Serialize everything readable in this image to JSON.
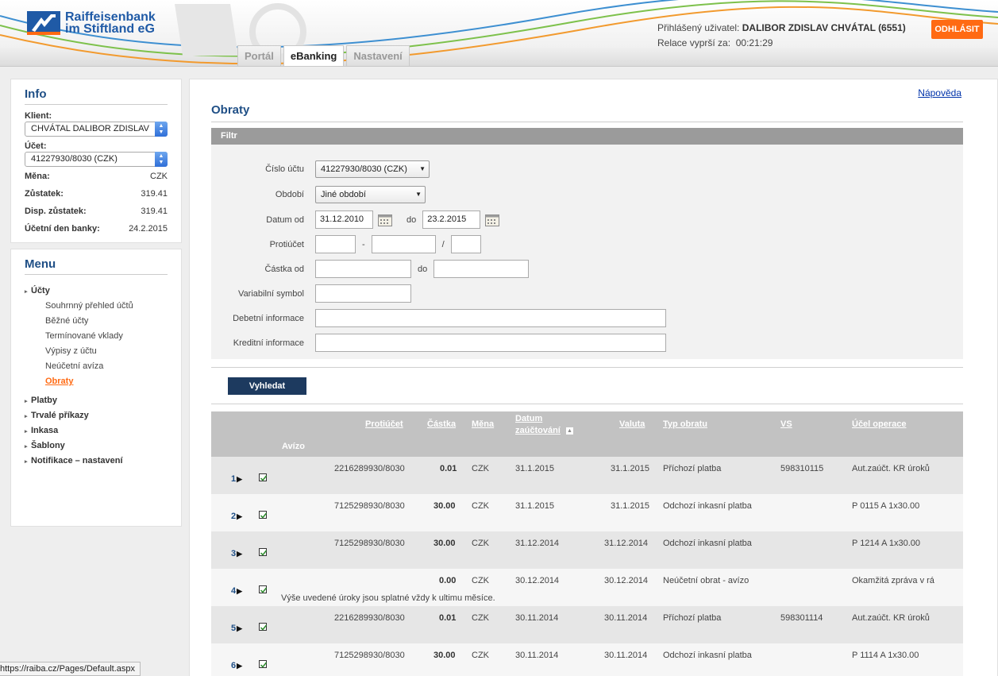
{
  "header": {
    "logo_line1": "Raiffeisenbank",
    "logo_line2": "im Stiftland eG",
    "user_label": "Přihlášený uživatel:",
    "user_name": "DALIBOR ZDISLAV CHVÁTAL (6551)",
    "session_label": "Relace vyprší za:",
    "session_time": "00:21:29",
    "logout": "ODHLÁSIT",
    "tabs": [
      {
        "label": "Portál"
      },
      {
        "label": "eBanking"
      },
      {
        "label": "Nastavení"
      }
    ]
  },
  "info": {
    "title": "Info",
    "client_label": "Klient:",
    "client_value": "CHVÁTAL DALIBOR ZDISLAV",
    "account_label": "Účet:",
    "account_value": "41227930/8030 (CZK)",
    "currency_label": "Měna:",
    "currency_value": "CZK",
    "balance_label": "Zůstatek:",
    "balance_value": "319.41",
    "disp_label": "Disp. zůstatek:",
    "disp_value": "319.41",
    "bank_day_label": "Účetní den banky:",
    "bank_day_value": "24.2.2015"
  },
  "menu": {
    "title": "Menu",
    "accounts": "Účty",
    "submenu": [
      "Souhrnný přehled účtů",
      "Běžné účty",
      "Termínované vklady",
      "Výpisy z účtu",
      "Neúčetní avíza",
      "Obraty"
    ],
    "items": [
      "Platby",
      "Trvalé příkazy",
      "Inkasa",
      "Šablony",
      "Notifikace – nastavení"
    ]
  },
  "main": {
    "help": "Nápověda",
    "title": "Obraty",
    "filter_title": "Filtr",
    "filter": {
      "account_label": "Číslo účtu",
      "account_value": "41227930/8030 (CZK)",
      "period_label": "Období",
      "period_value": "Jiné období",
      "date_from_label": "Datum od",
      "date_from": "31.12.2010",
      "to_label": "do",
      "date_to": "23.2.2015",
      "counter_label": "Protiúčet",
      "dash": "-",
      "slash": "/",
      "amount_label": "Částka od",
      "vs_label": "Variabilní symbol",
      "debit_label": "Debetní informace",
      "credit_label": "Kreditní informace"
    },
    "search": "Vyhledat"
  },
  "table": {
    "headers": {
      "counter": "Protiúčet",
      "amount": "Částka",
      "currency": "Měna",
      "date1": "Datum",
      "date2": "zaúčtování",
      "valuta": "Valuta",
      "type": "Typ obratu",
      "vs": "VS",
      "purpose": "Účel operace",
      "aviso": "Avízo"
    },
    "rows": [
      {
        "n": "1",
        "counter": "2216289930/8030",
        "amount": "0.01",
        "cur": "CZK",
        "date": "31.1.2015",
        "valuta": "31.1.2015",
        "type": "Příchozí platba",
        "vs": "598310115",
        "purpose": "Aut.zaúčt. KR úroků",
        "note": ""
      },
      {
        "n": "2",
        "counter": "7125298930/8030",
        "amount": "30.00",
        "cur": "CZK",
        "date": "31.1.2015",
        "valuta": "31.1.2015",
        "type": "Odchozí inkasní platba",
        "vs": "",
        "purpose": "P 0115 A 1x30.00",
        "note": ""
      },
      {
        "n": "3",
        "counter": "7125298930/8030",
        "amount": "30.00",
        "cur": "CZK",
        "date": "31.12.2014",
        "valuta": "31.12.2014",
        "type": "Odchozí inkasní platba",
        "vs": "",
        "purpose": "P 1214 A 1x30.00",
        "note": ""
      },
      {
        "n": "4",
        "counter": "",
        "amount": "0.00",
        "cur": "CZK",
        "date": "30.12.2014",
        "valuta": "30.12.2014",
        "type": "Neúčetní obrat - avízo",
        "vs": "",
        "purpose": "Okamžitá zpráva v rá",
        "note": "Výše uvedené úroky jsou splatné vždy k ultimu měsíce."
      },
      {
        "n": "5",
        "counter": "2216289930/8030",
        "amount": "0.01",
        "cur": "CZK",
        "date": "30.11.2014",
        "valuta": "30.11.2014",
        "type": "Příchozí platba",
        "vs": "598301114",
        "purpose": "Aut.zaúčt. KR úroků",
        "note": ""
      },
      {
        "n": "6",
        "counter": "7125298930/8030",
        "amount": "30.00",
        "cur": "CZK",
        "date": "30.11.2014",
        "valuta": "30.11.2014",
        "type": "Odchozí inkasní platba",
        "vs": "",
        "purpose": "P 1114 A 1x30.00",
        "note": ""
      }
    ]
  },
  "status_url": "https://raiba.cz/Pages/Default.aspx"
}
